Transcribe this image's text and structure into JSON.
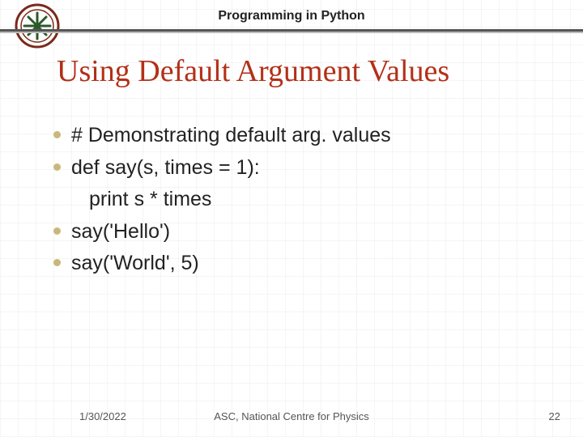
{
  "header": {
    "course_title": "Programming in Python"
  },
  "logo": {
    "name": "institution-seal"
  },
  "slide": {
    "title": "Using Default Argument Values",
    "lines": [
      {
        "text": "# Demonstrating default arg. values",
        "indent": false
      },
      {
        "text": "def say(s, times = 1):",
        "indent": false
      },
      {
        "text": "print s * times",
        "indent": true
      },
      {
        "text": "say('Hello')",
        "indent": false
      },
      {
        "text": "say('World', 5)",
        "indent": false
      }
    ]
  },
  "footer": {
    "date": "1/30/2022",
    "center": "ASC, National Centre for Physics",
    "page": "22"
  },
  "colors": {
    "title": "#b33018",
    "bullet": "#c9b87a"
  }
}
